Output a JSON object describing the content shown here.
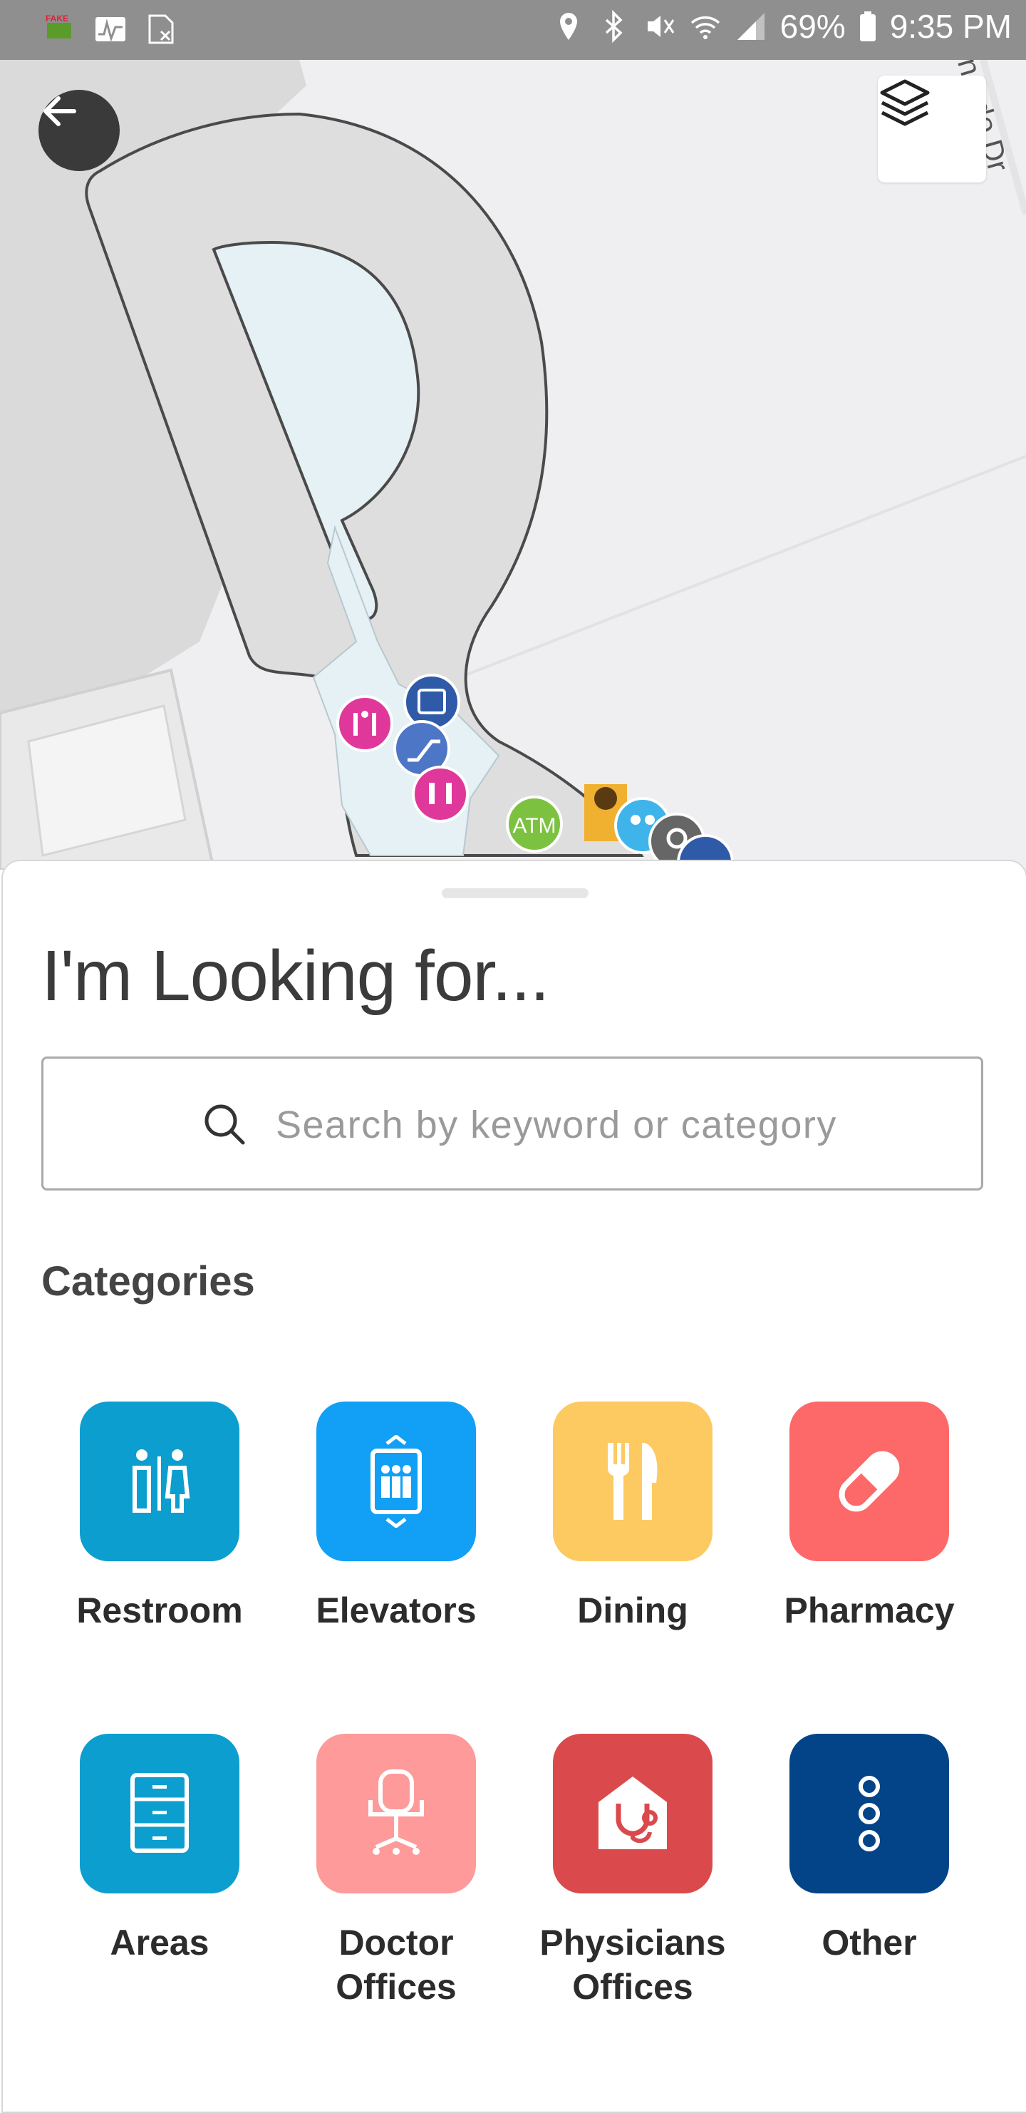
{
  "status_bar": {
    "battery": "69%",
    "time": "9:35 PM",
    "left_icons": [
      "fake-gps-icon",
      "activity-icon",
      "carrier-no-sim-icon"
    ],
    "right_icons": [
      "location-icon",
      "bluetooth-icon",
      "mute-icon",
      "wifi-icon",
      "signal-icon",
      "battery-icon"
    ]
  },
  "map": {
    "street_label": "ernardo Dr",
    "poi_labels": {
      "atm": "ATM"
    },
    "colors": {
      "background": "#efeff1",
      "building_fill": "#dedede",
      "courtyard": "#e5f1f5",
      "outline": "#4a4a4a"
    }
  },
  "sheet": {
    "title": "I'm Looking for...",
    "search": {
      "placeholder": "Search by keyword or category"
    },
    "categories_title": "Categories",
    "categories": [
      {
        "label": "Restroom",
        "icon": "restroom-icon",
        "color": "#0c9ecf"
      },
      {
        "label": "Elevators",
        "icon": "elevator-icon",
        "color": "#11a0f5"
      },
      {
        "label": "Dining",
        "icon": "dining-icon",
        "color": "#fdca62"
      },
      {
        "label": "Pharmacy",
        "icon": "pharmacy-icon",
        "color": "#fd6868"
      },
      {
        "label": "Areas",
        "icon": "cabinet-icon",
        "color": "#0c9ecf"
      },
      {
        "label": "Doctor\nOffices",
        "icon": "office-chair-icon",
        "color": "#fe9a9a"
      },
      {
        "label": "Physicians\nOffices",
        "icon": "stethoscope-house-icon",
        "color": "#da4a4d"
      },
      {
        "label": "Other",
        "icon": "more-vertical-icon",
        "color": "#034488"
      }
    ]
  }
}
